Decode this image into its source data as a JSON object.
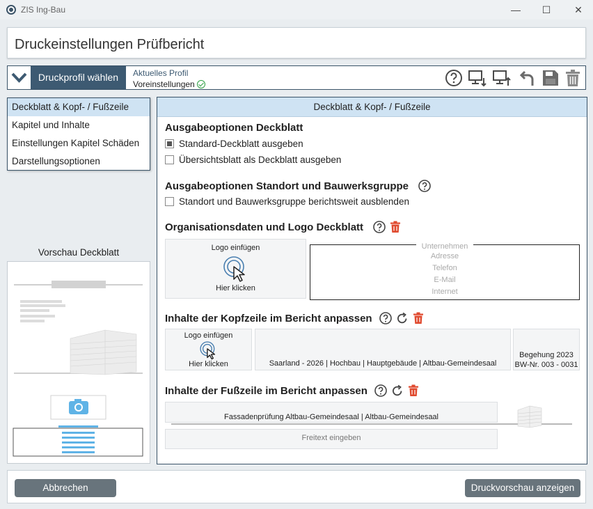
{
  "window": {
    "app_title": "ZIS Ing-Bau",
    "minimize": "—",
    "maximize": "☐",
    "close": "✕"
  },
  "header": {
    "title": "Druckeinstellungen Prüfbericht"
  },
  "profile": {
    "button_label": "Druckprofil wählen",
    "current_label": "Aktuelles Profil",
    "current_value": "Voreinstellungen",
    "toolbar_icons": [
      "help-icon",
      "monitor-download-icon",
      "monitor-upload-icon",
      "undo-icon",
      "save-icon",
      "trash-icon"
    ]
  },
  "nav": {
    "items": [
      {
        "label": "Deckblatt & Kopf- / Fußzeile",
        "active": true
      },
      {
        "label": "Kapitel und Inhalte",
        "active": false
      },
      {
        "label": "Einstellungen Kapitel Schäden",
        "active": false
      },
      {
        "label": "Darstellungsoptionen",
        "active": false
      }
    ]
  },
  "preview": {
    "label": "Vorschau Deckblatt"
  },
  "panel": {
    "title": "Deckblatt & Kopf- / Fußzeile",
    "cover": {
      "heading": "Ausgabeoptionen Deckblatt",
      "options": [
        {
          "label": "Standard-Deckblatt ausgeben",
          "checked": true
        },
        {
          "label": "Übersichtsblatt als Deckblatt ausgeben",
          "checked": false
        }
      ]
    },
    "location": {
      "heading": "Ausgabeoptionen Standort und Bauwerksgruppe",
      "option": {
        "label": "Standort und Bauwerksgruppe berichtsweit ausblenden",
        "checked": false
      }
    },
    "org": {
      "heading": "Organisationsdaten und Logo Deckblatt",
      "logo_top": "Logo einfügen",
      "logo_bottom": "Hier klicken",
      "fields": [
        "Unternehmen",
        "Adresse",
        "Telefon",
        "E-Mail",
        "Internet"
      ]
    },
    "header_content": {
      "heading": "Inhalte der Kopfzeile im Bericht anpassen",
      "logo_top": "Logo einfügen",
      "logo_bottom": "Hier klicken",
      "center_text": "Saarland - 2026 | Hochbau | Hauptgebäude | Altbau-Gemeindesaal",
      "right_line1": "Begehung 2023",
      "right_line2": "BW-Nr. 003 - 0031"
    },
    "footer_content": {
      "heading": "Inhalte der Fußzeile im Bericht anpassen",
      "line1": "Fassadenprüfung Altbau-Gemeindesaal | Altbau-Gemeindesaal",
      "placeholder": "Freitext eingeben"
    }
  },
  "footer": {
    "cancel": "Abbrechen",
    "preview": "Druckvorschau anzeigen"
  },
  "colors": {
    "accent": "#3d5a72",
    "selection": "#cfe3f3",
    "delete": "#e04a2f",
    "success": "#2ea043",
    "preview_blue": "#5fb3e6"
  }
}
